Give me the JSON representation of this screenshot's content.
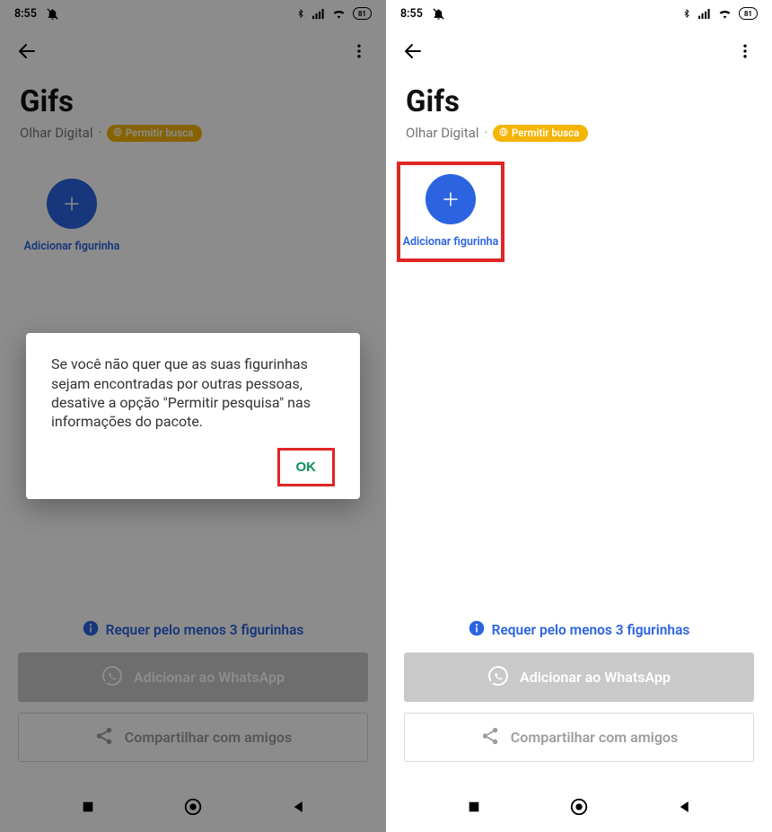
{
  "statusbar": {
    "time": "8:55",
    "battery": "81"
  },
  "toolbar": {},
  "page": {
    "title": "Gifs",
    "author": "Olhar Digital",
    "badge": "Permitir busca",
    "add_label": "Adicionar figurinha"
  },
  "bottom": {
    "requirement": "Requer pelo menos 3 figurinhas",
    "whatsapp_btn": "Adicionar ao WhatsApp",
    "share_btn": "Compartilhar com amigos"
  },
  "dialog": {
    "message": "Se você não quer que as suas figurinhas sejam encontradas por outras pessoas, desative a opção \"Permitir pesquisa\" nas informações do pacote.",
    "ok": "OK"
  }
}
